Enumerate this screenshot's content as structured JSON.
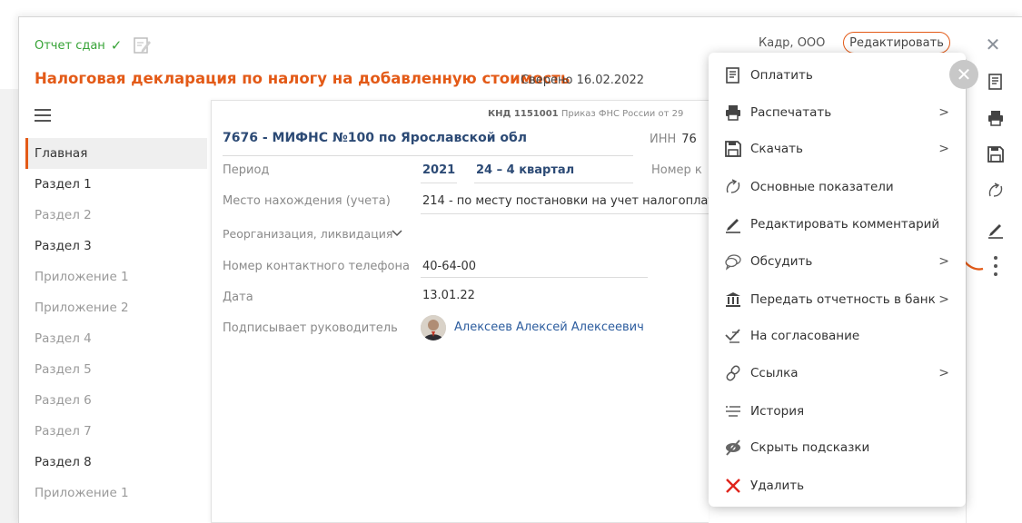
{
  "header": {
    "status": "Отчет сдан",
    "title": "Налоговая декларация по налогу на добавленную стоимость",
    "reconciled": "Сверено 16.02.2022",
    "company": "Кадр, ООО",
    "edit_label": "Редактировать"
  },
  "sidebar": {
    "items": [
      {
        "label": "Главная"
      },
      {
        "label": "Раздел 1"
      },
      {
        "label": "Раздел 2"
      },
      {
        "label": "Раздел 3"
      },
      {
        "label": "Приложение 1"
      },
      {
        "label": "Приложение 2"
      },
      {
        "label": "Раздел 4"
      },
      {
        "label": "Раздел 5"
      },
      {
        "label": "Раздел 6"
      },
      {
        "label": "Раздел 7"
      },
      {
        "label": "Раздел 8"
      },
      {
        "label": "Приложение 1"
      }
    ]
  },
  "form": {
    "knd_code": "КНД 1151001",
    "knd_order": "Приказ ФНС России от 29",
    "org": "7676 - МИФНС №100 по Ярославской обл",
    "inn_label": "ИНН",
    "inn_value": "76",
    "period_label": "Период",
    "period_year": "2021",
    "period_quarter": "24 – 4 квартал",
    "number_label": "Номер к",
    "location_label": "Место нахождения (учета)",
    "location_value": "214 - по месту постановки на учет налогоплате",
    "reorg_label": "Реорганизация, ликвидация",
    "phone_label": "Номер контактного телефона",
    "phone_value": "40-64-00",
    "date_label": "Дата",
    "date_value": "13.01.22",
    "signer_label": "Подписывает руководитель",
    "signer_value": "Алексеев Алексей Алексеевич"
  },
  "menu": {
    "items": [
      {
        "label": "Оплатить",
        "icon": "receipt-icon",
        "submenu": false
      },
      {
        "label": "Распечатать",
        "icon": "printer-icon",
        "submenu": true
      },
      {
        "label": "Скачать",
        "icon": "floppy-disk-icon",
        "submenu": true
      },
      {
        "label": "Основные показатели",
        "icon": "indicators-icon",
        "submenu": false
      },
      {
        "label": "Редактировать комментарий",
        "icon": "pen-icon",
        "submenu": false
      },
      {
        "label": "Обсудить",
        "icon": "chat-icon",
        "submenu": true
      },
      {
        "label": "Передать отчетность в банк",
        "icon": "bank-icon",
        "submenu": true
      },
      {
        "label": "На согласование",
        "icon": "approval-icon",
        "submenu": false
      },
      {
        "label": "Ссылка",
        "icon": "link-icon",
        "submenu": true
      },
      {
        "label": "История",
        "icon": "history-icon",
        "submenu": false
      },
      {
        "label": "Скрыть подсказки",
        "icon": "hide-hints-icon",
        "submenu": false
      },
      {
        "label": "Удалить",
        "icon": "delete-icon",
        "submenu": false
      }
    ]
  },
  "colors": {
    "accent": "#e35a17",
    "status_green": "#36a336",
    "link_blue": "#2c5c9e",
    "delete_red": "#e0241b"
  }
}
